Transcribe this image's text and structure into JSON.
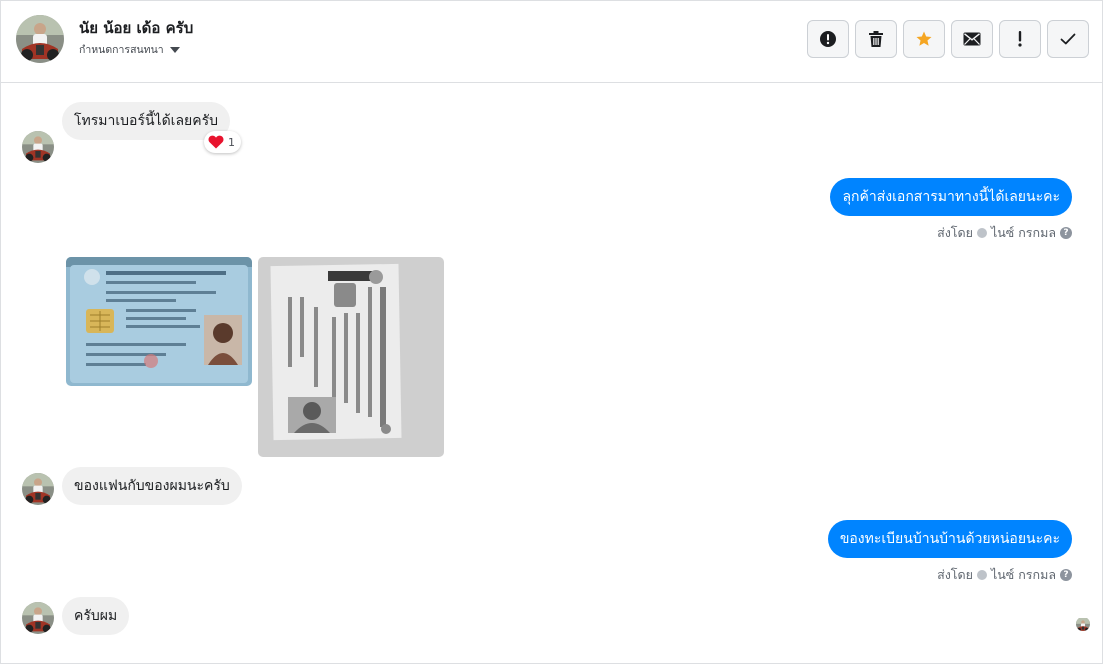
{
  "header": {
    "name": "นัย น้อย เด้อ ครับ",
    "subtitle": "กำหนดการสนทนา",
    "avatar_icon": "profile-photo",
    "actions": [
      {
        "name": "report-button",
        "icon": "exclamation-circle-icon"
      },
      {
        "name": "delete-button",
        "icon": "trash-icon"
      },
      {
        "name": "star-button",
        "icon": "star-icon"
      },
      {
        "name": "mark-unread-button",
        "icon": "envelope-icon"
      },
      {
        "name": "spam-button",
        "icon": "exclamation-icon"
      },
      {
        "name": "done-button",
        "icon": "check-icon"
      }
    ],
    "colors": {
      "star": "#f5a623",
      "icon": "#1c1e21"
    }
  },
  "messages": [
    {
      "id": "m1",
      "direction": "in",
      "text": "โทรมาเบอร์นี้ได้เลยครับ",
      "reaction": {
        "emoji": "heart",
        "count": "1"
      }
    },
    {
      "id": "m2",
      "direction": "out",
      "text": "ลุกค้าส่งเอกสารมาทางนี้ได้เลยนะคะ",
      "meta": {
        "prefix": "ส่งโดย",
        "sender": "ไนซ์ กรกมล",
        "help": "?"
      }
    },
    {
      "id": "m3",
      "direction": "in",
      "type": "images",
      "images": [
        {
          "description": "thai-id-card-front"
        },
        {
          "description": "thai-id-card-photocopy"
        }
      ]
    },
    {
      "id": "m4",
      "direction": "in",
      "text": "ของแฟนกับของผมนะครับ"
    },
    {
      "id": "m5",
      "direction": "out",
      "text": "ของทะเบียนบ้านบ้านด้วยหน่อยนะคะ",
      "meta": {
        "prefix": "ส่งโดย",
        "sender": "ไนซ์ กรกมล",
        "help": "?"
      }
    },
    {
      "id": "m6",
      "direction": "in",
      "text": "ครับผม"
    }
  ],
  "colors": {
    "outgoing_bubble": "#0084ff",
    "incoming_bubble": "#f0f0f0",
    "border": "#dddfe2"
  }
}
